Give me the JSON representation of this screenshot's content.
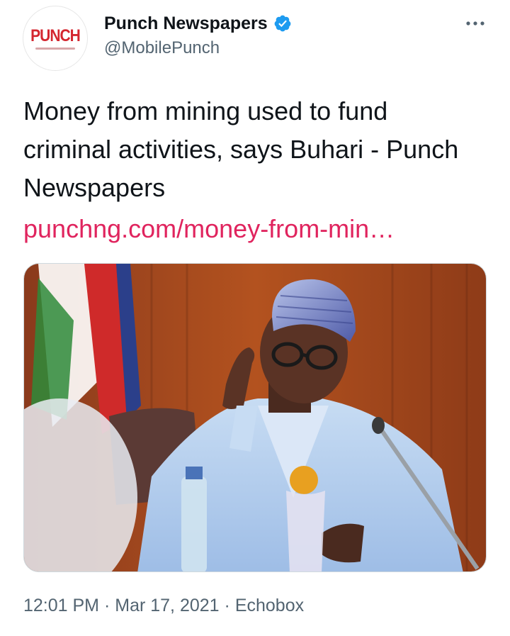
{
  "account": {
    "display_name": "Punch Newspapers",
    "handle": "@MobilePunch",
    "verified": true,
    "avatar_logo_text": "PUNCH",
    "avatar_logo_color": "#d4262f",
    "verified_color": "#1d9bf0"
  },
  "more_icon": "more-horizontal-icon",
  "tweet": {
    "text": "Money from mining used to fund criminal activities, says Buhari - Punch Newspapers",
    "link": "punchng.com/money-from-min…",
    "link_color": "#e0245e"
  },
  "meta": {
    "time": "12:01 PM",
    "separator": "·",
    "date": "Mar 17, 2021",
    "source": "Echobox"
  }
}
